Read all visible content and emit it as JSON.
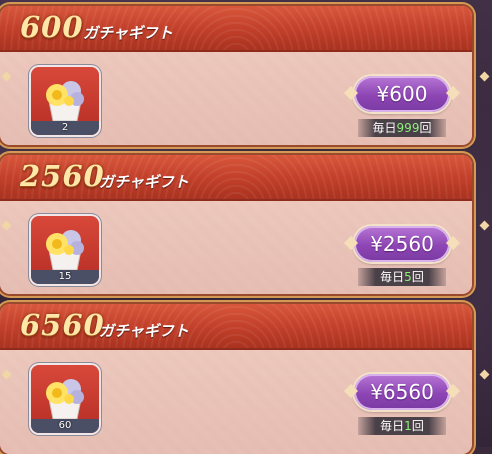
{
  "packs": [
    {
      "amount": "600",
      "gift_label": "ガチャギフト",
      "item_quantity": "2",
      "price": "¥600",
      "limit_prefix": "毎日",
      "limit_count": "999",
      "limit_suffix": "回"
    },
    {
      "amount": "2560",
      "gift_label": "ガチャギフト",
      "item_quantity": "15",
      "price": "¥2560",
      "limit_prefix": "毎日",
      "limit_count": "5",
      "limit_suffix": "回"
    },
    {
      "amount": "6560",
      "gift_label": "ガチャギフト",
      "item_quantity": "60",
      "price": "¥6560",
      "limit_prefix": "毎日",
      "limit_count": "1",
      "limit_suffix": "回"
    }
  ],
  "icons": {
    "item": "flower-bouquet-icon"
  },
  "colors": {
    "header_red": "#c13f2a",
    "card_bg": "#e5bcb1",
    "price_button_purple": "#8d45b4",
    "limit_count_green": "#8ff07a",
    "amount_gold": "#ffe7a8"
  }
}
